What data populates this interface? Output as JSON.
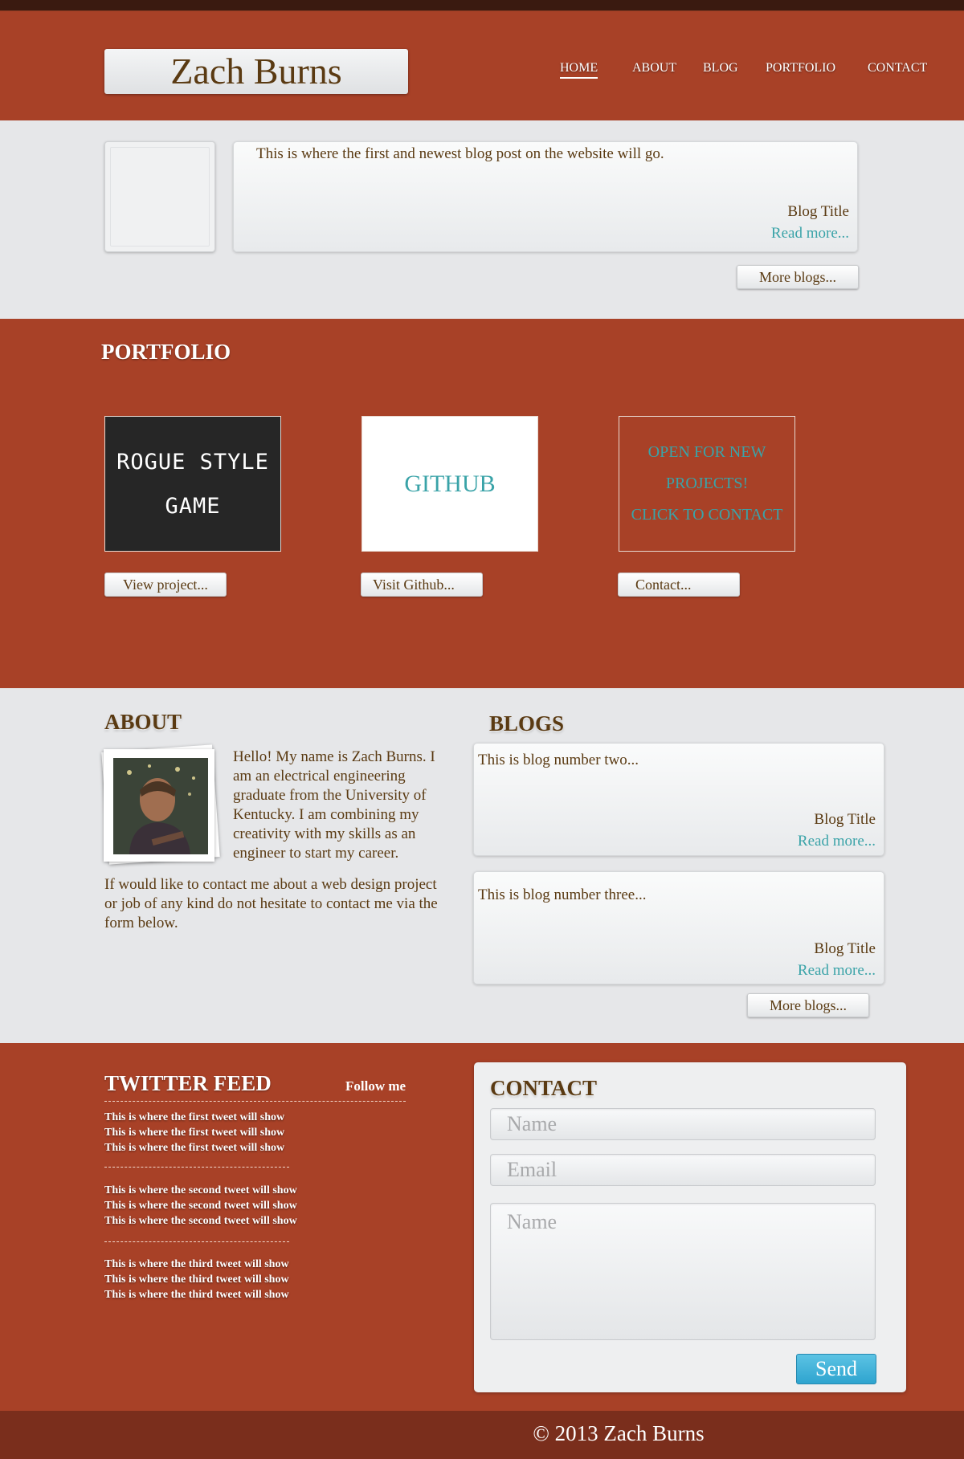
{
  "header": {
    "logo": "Zach Burns",
    "nav": [
      "HOME",
      "ABOUT",
      "BLOG",
      "PORTFOLIO",
      "CONTACT"
    ]
  },
  "featured": {
    "text": "This is where the first and newest blog post on the website will go.",
    "title": "Blog Title",
    "read_more": "Read more...",
    "more_button": "More blogs..."
  },
  "portfolio": {
    "heading": "PORTFOLIO",
    "tiles": [
      {
        "lines": [
          "ROGUE STYLE",
          "GAME"
        ],
        "button": "View project..."
      },
      {
        "lines": [
          "GITHUB"
        ],
        "button": "Visit Github..."
      },
      {
        "lines": [
          "OPEN FOR NEW",
          "PROJECTS!",
          "CLICK TO CONTACT"
        ],
        "button": "Contact..."
      }
    ]
  },
  "about": {
    "heading": "ABOUT",
    "intro": "Hello! My name is Zach Burns. I am an electrical engineering graduate from the University of Kentucky. I am combining my creativity with my skills as an engineer to start my career.",
    "contact_note": "If would like to contact me about a web design project or job of any kind do not hesitate to contact me via the form below."
  },
  "blogs": {
    "heading": "BLOGS",
    "items": [
      {
        "text": "This is blog number two...",
        "title": "Blog Title",
        "read_more": "Read more..."
      },
      {
        "text": "This is blog number three...",
        "title": "Blog Title",
        "read_more": "Read more..."
      }
    ],
    "more_button": "More blogs..."
  },
  "twitter": {
    "heading": "TWITTER FEED",
    "follow": "Follow me",
    "tweets": [
      [
        "This is where the first tweet will show",
        "This is where the first tweet will show",
        "This is where the first tweet will show"
      ],
      [
        "This is where the second tweet will show",
        "This is where the second tweet will show",
        "This is where the second tweet will show"
      ],
      [
        "This is where the third tweet will show",
        "This is where the third tweet will show",
        "This is where the third tweet will show"
      ]
    ]
  },
  "contact": {
    "heading": "CONTACT",
    "name_placeholder": "Name",
    "email_placeholder": "Email",
    "message_placeholder": "Name",
    "send": "Send"
  },
  "footer": {
    "copyright": "© 2013 Zach Burns"
  }
}
